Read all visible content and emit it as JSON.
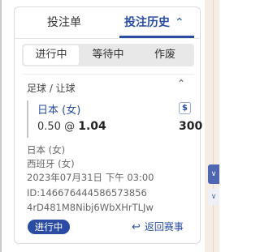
{
  "tabs": [
    {
      "label": "投注单",
      "active": false
    },
    {
      "label": "投注历史",
      "active": true
    }
  ],
  "history_chevron": "^",
  "segments": [
    "进行中",
    "等待中",
    "作废"
  ],
  "active_segment": "进行中",
  "bet": {
    "sport_market": "足球 / 让球",
    "pick": "日本 (女)",
    "handicap": "0.50",
    "at": "@",
    "odds": "1.04",
    "stake": "300",
    "cashout_icon": "$",
    "home_team": "日本 (女)",
    "away_team": "西班牙 (女)",
    "datetime": "2023年07月31日 下午 03:00",
    "bet_id": "ID:146676444586573856",
    "ref_code": "4rD481M8Nibj6WbXHrTLJw",
    "status": "进行中",
    "back_link": "返回赛事"
  },
  "colors": {
    "accent": "#2a4da3",
    "side_strip": "#f6ede5"
  }
}
